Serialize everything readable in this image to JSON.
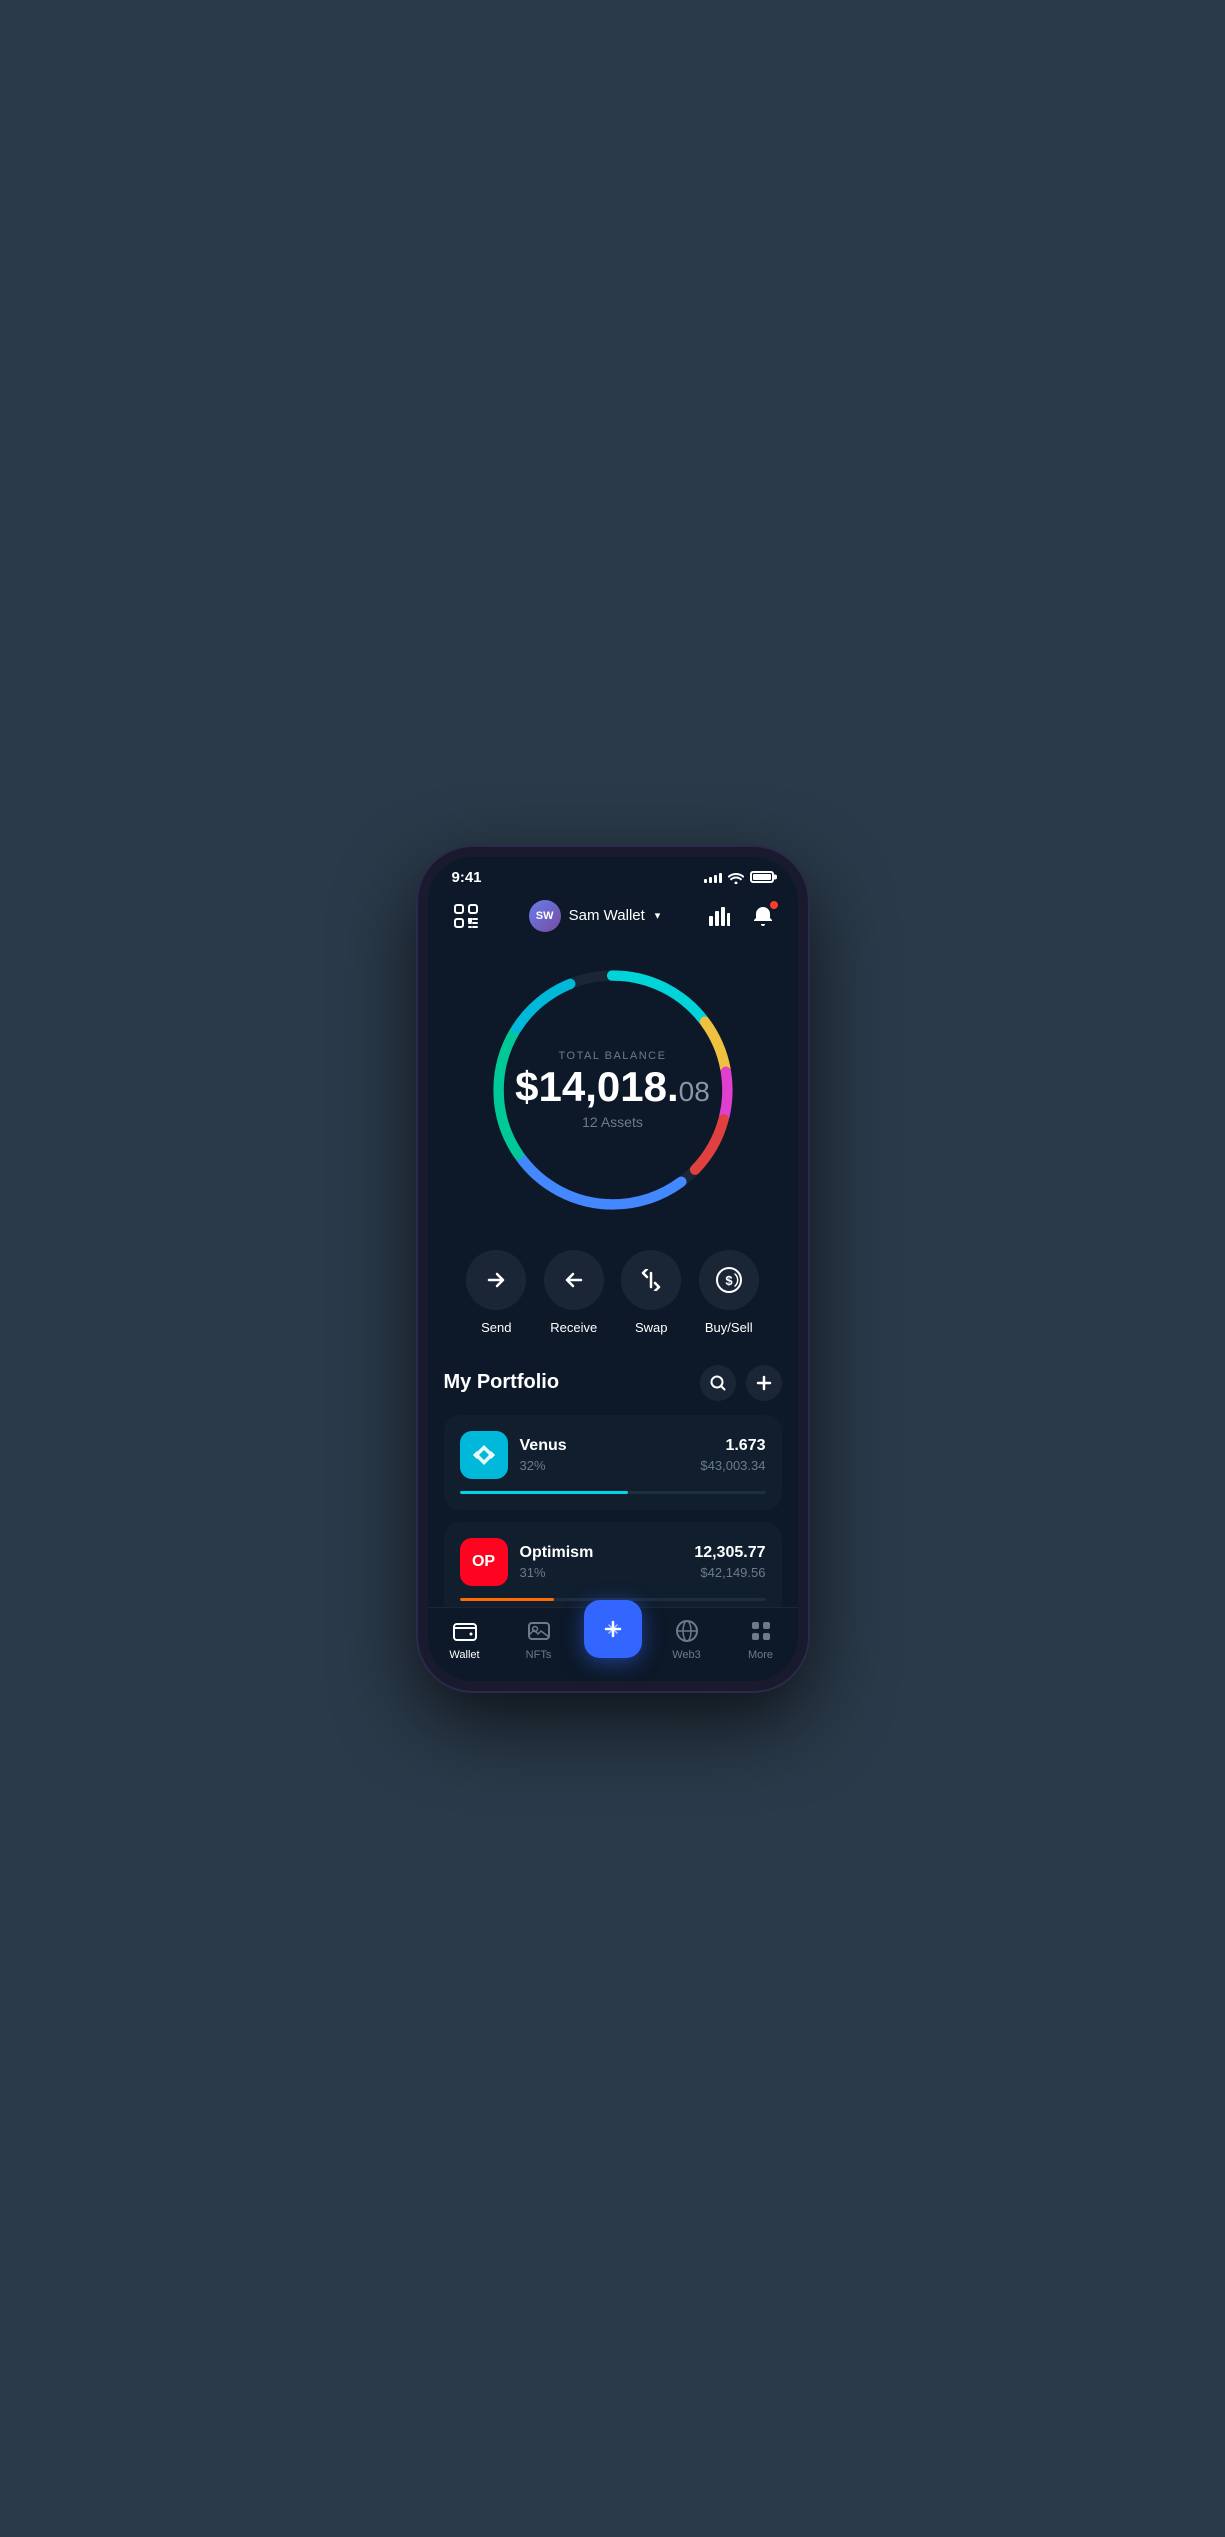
{
  "status_bar": {
    "time": "9:41"
  },
  "header": {
    "scan_label": "scan",
    "user": {
      "initials": "SW",
      "name": "Sam Wallet",
      "chevron": "▾"
    },
    "chart_icon_label": "chart",
    "bell_icon_label": "bell"
  },
  "balance": {
    "label": "TOTAL BALANCE",
    "main": "$14,018.",
    "cents": "08",
    "assets_label": "12 Assets"
  },
  "actions": [
    {
      "id": "send",
      "label": "Send"
    },
    {
      "id": "receive",
      "label": "Receive"
    },
    {
      "id": "swap",
      "label": "Swap"
    },
    {
      "id": "buysell",
      "label": "Buy/Sell"
    }
  ],
  "portfolio": {
    "title": "My Portfolio",
    "search_label": "search",
    "add_label": "add"
  },
  "assets": [
    {
      "id": "venus",
      "name": "Venus",
      "percentage": "32%",
      "amount": "1.673",
      "usd": "$43,003.34",
      "progress_pct": 55
    },
    {
      "id": "optimism",
      "name": "Optimism",
      "percentage": "31%",
      "amount": "12,305.77",
      "usd": "$42,149.56",
      "progress_pct": 31
    }
  ],
  "bottom_nav": [
    {
      "id": "wallet",
      "label": "Wallet",
      "active": true
    },
    {
      "id": "nfts",
      "label": "NFTs",
      "active": false
    },
    {
      "id": "center",
      "label": "",
      "active": false,
      "is_center": true
    },
    {
      "id": "web3",
      "label": "Web3",
      "active": false
    },
    {
      "id": "more",
      "label": "More",
      "active": false
    }
  ]
}
